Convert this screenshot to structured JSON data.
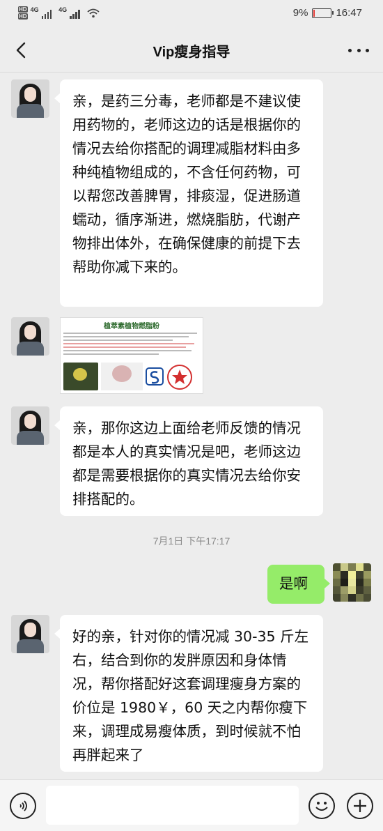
{
  "status_bar": {
    "network_tags": [
      "HD",
      "HD"
    ],
    "network_1": "4G",
    "network_2": "4G",
    "battery_percent": "9%",
    "time": "16:47",
    "battery_level_fraction": 0.09,
    "battery_color": "#e53935"
  },
  "header": {
    "back_icon": "chevron-left-icon",
    "title": "Vip瘦身指导",
    "more_icon": "more-dots-icon"
  },
  "messages": [
    {
      "sender": "other",
      "type": "text",
      "text": "亲，是药三分毒，老师都是不建议使用药物的，老师这边的话是根据你的情况去给你搭配的调理减脂材料由多种纯植物组成的，不含任何药物，可以帮您改善脾胃，排痰湿，促进肠道蠕动，循序渐进，燃烧脂肪，代谢产物排出体外，在确保健康的前提下去帮助你减下来的。"
    },
    {
      "sender": "other",
      "type": "image",
      "image_title": "植萃素植物燃脂粉"
    },
    {
      "sender": "other",
      "type": "text",
      "text": "亲，那你这边上面给老师反馈的情况都是本人的真实情况是吧，老师这边都是需要根据你的真实情况去给你安排搭配的。"
    },
    {
      "type": "timestamp",
      "text": "7月1日 下午17:17"
    },
    {
      "sender": "self",
      "type": "text",
      "text": "是啊"
    },
    {
      "sender": "other",
      "type": "text",
      "text": "好的亲，针对你的情况减 30-35 斤左右，结合到你的发胖原因和身体情况，帮你搭配好这套调理瘦身方案的价位是 1980￥，60 天之内帮你瘦下来，调理成易瘦体质，到时候就不怕再胖起来了"
    }
  ],
  "input_bar": {
    "voice_icon": "voice-icon",
    "input_value": "",
    "emoji_icon": "emoji-icon",
    "plus_icon": "plus-icon"
  },
  "colors": {
    "background": "#ededed",
    "self_bubble": "#95ec69",
    "other_bubble": "#ffffff"
  }
}
